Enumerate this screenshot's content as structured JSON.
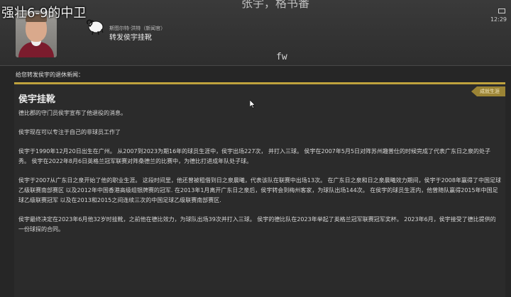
{
  "video_caption": "强壮6-9的中卫",
  "window_title_partial": "张宇，格书番",
  "system": {
    "battery_icon": "battery-icon",
    "time": "12:29"
  },
  "message": {
    "sender": "斯图尔特·洪特（新闻官）",
    "subject": "转发侯宇挂靴",
    "forwarded_label": "fw"
  },
  "intro_line": "给您转发侯宇的退休新闻：",
  "news": {
    "title": "侯宇挂靴",
    "tag": "成就生涯",
    "paragraphs": [
      "德比郡的守门员侯宇宣布了他退役的消息。",
      "侯宇现在可以专注于自己的非球员工作了",
      "侯宇于1990年12月20日出生在广州。 从2007到2023为期16年的球员生涯中，侯宇出场227次， 并打入三球。 侯宇在2007年5月5日对阵苏州趣普仕的时候完成了代表广东日之泉的处子秀。 侯宇在2022年8月6日英格兰冠军联赛对阵桑德兰的比赛中，为德比打进成年队处子球。",
      "侯宇于2007从广东日之泉开始了他的职业生涯。 这段时间里，他还曾被租借到日之泉晨曦，代表该队在联赛中出场13次。 在广东日之泉和日之泉晨曦效力期间，侯宇于2008年赢得了中国足球乙级联赛南部赛区 以及2012年中国香港高级组银牌赛的冠军. 在2013年1月离开广东日之泉后，侯宇转会到梅州客家，为球队出场144次。 在侯宇的球员生涯内，他曾随队赢得2015年中国足球乙级联赛冠军 以及在2013和2015之间连续三次的中国足球乙级联赛南部赛区.",
      "侯宇最终决定在2023年6月他32岁时挂靴，之前他在德比效力，为球队出场39次并打入三球。 侯宇的德比队在2023年举起了英格兰冠军联赛冠军奖杯。 2023年6月，侯宇接受了德比提供的一份球探的合同。"
    ]
  }
}
